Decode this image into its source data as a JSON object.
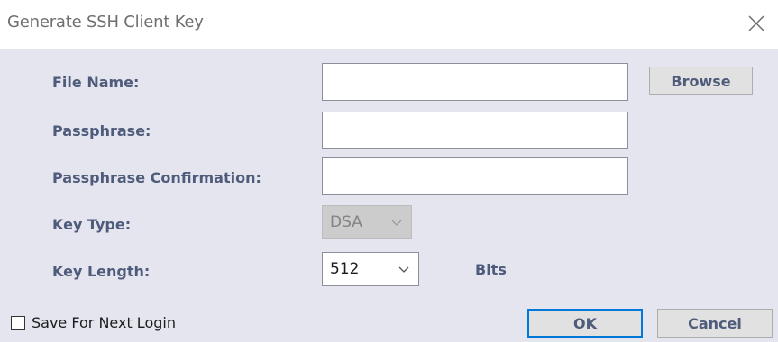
{
  "dialog": {
    "title": "Generate SSH Client Key"
  },
  "form": {
    "file_name_label": "File Name:",
    "file_name_value": "",
    "browse_label": "Browse",
    "passphrase_label": "Passphrase:",
    "passphrase_value": "",
    "passphrase_confirm_label": "Passphrase Confirmation:",
    "passphrase_confirm_value": "",
    "key_type_label": "Key Type:",
    "key_type_value": "DSA",
    "key_length_label": "Key Length:",
    "key_length_value": "512",
    "bits_label": "Bits"
  },
  "footer": {
    "save_login_label": "Save For Next Login",
    "save_login_checked": false,
    "ok_label": "OK",
    "cancel_label": "Cancel"
  },
  "colors": {
    "panel_bg": "#e4e5ef",
    "label_color": "#4f5b7a",
    "default_button_border": "#0078d7"
  },
  "icons": {
    "close": "close-icon",
    "key_type_dropdown": "chevron-down-icon",
    "key_length_dropdown": "chevron-down-icon"
  }
}
